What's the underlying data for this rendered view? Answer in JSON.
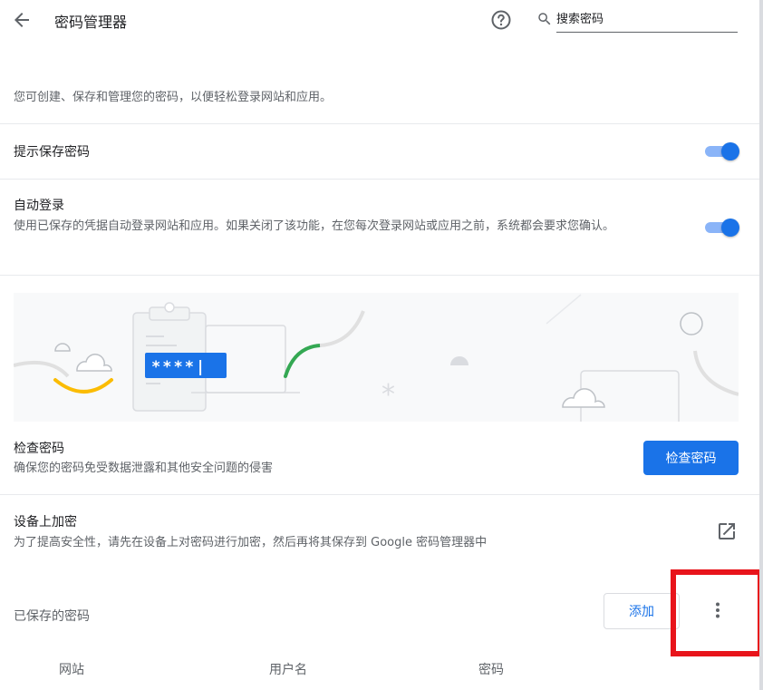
{
  "header": {
    "title": "密码管理器",
    "search_placeholder": "搜索密码"
  },
  "intro_text": "您可创建、保存和管理您的密码，以便轻松登录网站和应用。",
  "offer_to_save": {
    "label": "提示保存密码",
    "enabled": true
  },
  "auto_signin": {
    "label": "自动登录",
    "description": "使用已保存的凭据自动登录网站和应用。如果关闭了该功能，在您每次登录网站或应用之前，系统都会要求您确认。",
    "enabled": true
  },
  "illustration": {
    "password_mask": "****|"
  },
  "check_passwords": {
    "label": "检查密码",
    "description": "确保您的密码免受数据泄露和其他安全问题的侵害",
    "button": "检查密码"
  },
  "on_device_encryption": {
    "label": "设备上加密",
    "description": "为了提高安全性，请先在设备上对密码进行加密，然后再将其保存到 Google 密码管理器中"
  },
  "saved_passwords": {
    "title": "已保存的密码",
    "add_button": "添加",
    "columns": [
      "网站",
      "用户名",
      "密码"
    ]
  },
  "colors": {
    "accent": "#1a73e8",
    "highlight": "#e8141b"
  }
}
